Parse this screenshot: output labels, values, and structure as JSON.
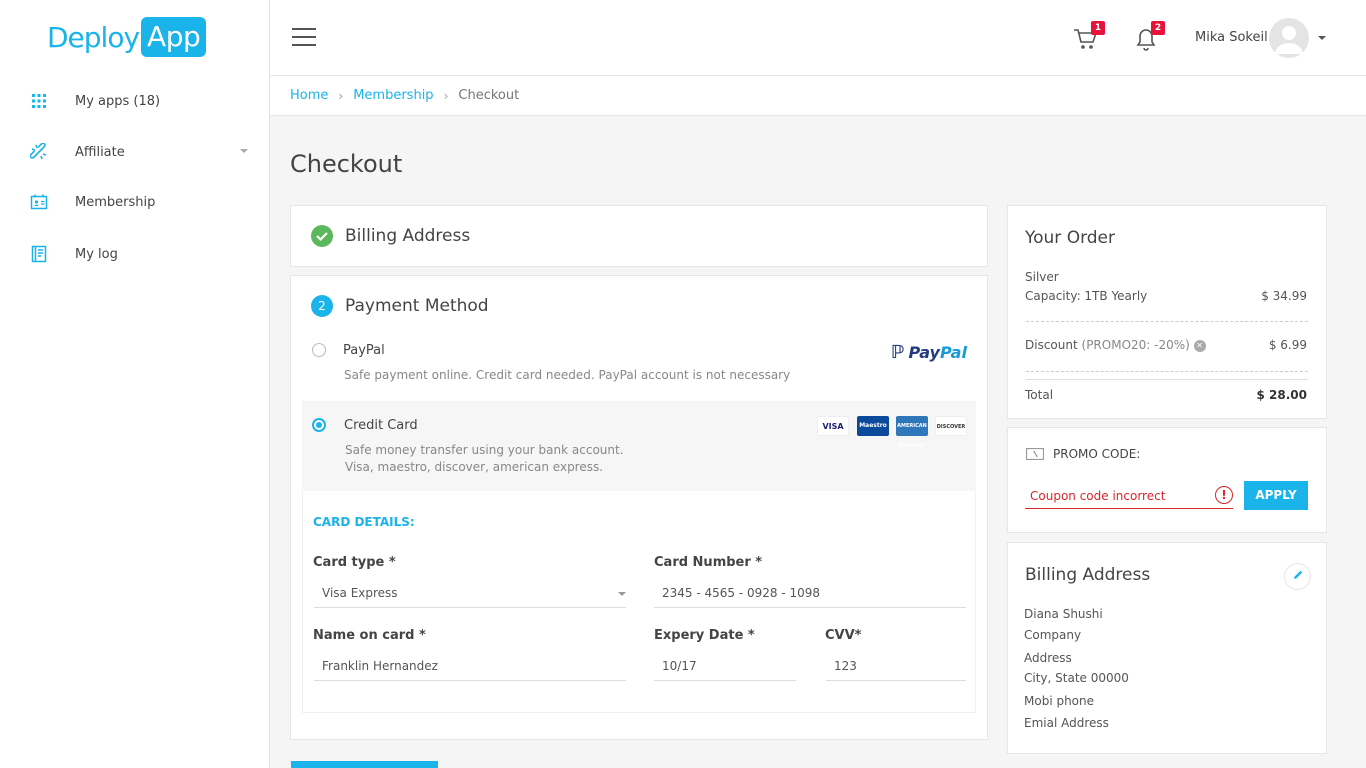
{
  "brand": {
    "name_part1": "Deploy",
    "name_part2": "App",
    "accent": "#1ab3ea"
  },
  "sidebar": {
    "items": [
      {
        "label": "My apps (18)",
        "icon": "grid-icon"
      },
      {
        "label": "Affiliate",
        "icon": "link-icon",
        "has_submenu": true
      },
      {
        "label": "Membership",
        "icon": "id-card-icon"
      },
      {
        "label": "My log",
        "icon": "log-book-icon"
      }
    ]
  },
  "header": {
    "cart_count": "1",
    "notifications_count": "2",
    "user_name": "Mika Sokeil"
  },
  "breadcrumb": {
    "items": [
      "Home",
      "Membership",
      "Checkout"
    ]
  },
  "page": {
    "title": "Checkout"
  },
  "steps": {
    "billing": {
      "title": "Billing Address",
      "status": "complete"
    },
    "payment": {
      "number": "2",
      "title": "Payment Method"
    }
  },
  "payment_options": {
    "paypal": {
      "title": "PayPal",
      "desc": "Safe payment online. Credit card needed. PayPal account is not necessary",
      "logo_part1": "Pay",
      "logo_part2": "Pal",
      "selected": false
    },
    "credit": {
      "title": "Credit  Card",
      "desc_line1": "Safe money transfer using your bank account.",
      "desc_line2": "Visa, maestro, discover, american express.",
      "selected": true,
      "logos": [
        "VISA",
        "Maestro",
        "AMERICAN EXPRESS",
        "DISCOVER"
      ]
    }
  },
  "card_details": {
    "heading": "CARD DETAILS:",
    "card_type_label": "Card type *",
    "card_type_value": "Visa Express",
    "card_number_label": "Card Number *",
    "card_number_value": "2345 - 4565 - 0928 - 1098",
    "name_label": "Name on card *",
    "name_value": "Franklin Hernandez",
    "expiry_label": "Expery Date *",
    "expiry_value": "10/17",
    "cvv_label": "CVV*",
    "cvv_value": "123"
  },
  "order": {
    "title": "Your Order",
    "plan": "Silver",
    "plan_detail": "Capacity: 1TB Yearly",
    "plan_price": "$ 34.99",
    "discount_label": "Discount",
    "discount_code": "(PROMO20: -20%)",
    "discount_value": "$ 6.99",
    "total_label": "Total",
    "total_value": "$ 28.00"
  },
  "promo": {
    "label": "PROMO CODE:",
    "value": "Coupon code incorrect",
    "apply_label": "APPLY",
    "error_color": "#d9262c"
  },
  "billing_address": {
    "title": "Billing Address",
    "lines": [
      "Diana Shushi",
      "Company",
      "Address",
      "City, State 00000",
      "Mobi phone",
      "Emial Address"
    ]
  }
}
